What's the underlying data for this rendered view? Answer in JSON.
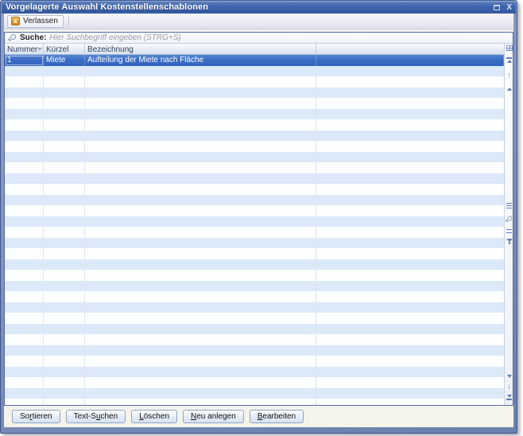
{
  "window": {
    "title": "Vorgelagerte Auswahl Kostenstellenschablonen",
    "close_glyph": "X"
  },
  "toolbar": {
    "leave_label": "Verlassen"
  },
  "search": {
    "label": "Suche:",
    "placeholder": "Hier Suchbegriff eingeben (STRG+S)"
  },
  "grid": {
    "columns": [
      "Nummer",
      "Kürzel",
      "Bezeichnung"
    ],
    "rows": [
      {
        "nummer": "1",
        "kuerzel": "Miete",
        "bezeichnung": "Aufteilung der Miete nach Fläche"
      }
    ],
    "empty_row_count": 32,
    "sort_column": "Nummer"
  },
  "footer": {
    "buttons": [
      {
        "label": "Sortieren",
        "mnemonic_index": 2
      },
      {
        "label": "Text-Suchen",
        "mnemonic_index": 6
      },
      {
        "label": "Löschen",
        "mnemonic_index": 0
      },
      {
        "label": "Neu anlegen",
        "mnemonic_index": 0
      },
      {
        "label": "Bearbeiten",
        "mnemonic_index": 0
      }
    ]
  },
  "icons": {
    "titlebar": [
      "restore-icon",
      "close-icon"
    ],
    "toolbar": "exit-icon",
    "search": "magnifier-icon",
    "header": "sort-descending-icon",
    "rail": [
      "customize-columns-icon",
      "scroll-to-top-icon",
      "scroll-up-icon",
      "page-up-icon",
      "expand-rows-icon",
      "zoom-icon",
      "edit-view-icon",
      "filter-icon",
      "page-down-icon",
      "scroll-down-icon",
      "scroll-to-bottom-icon"
    ]
  },
  "colors": {
    "titlebar_blue": "#3f64ab",
    "frame_blue": "#7487b4",
    "selection_blue": "#3d6fc8",
    "row_alt_blue": "#dce9f8",
    "exit_icon_amber": "#dd9a2e",
    "rail_icon_blue": "#5f7db5"
  }
}
